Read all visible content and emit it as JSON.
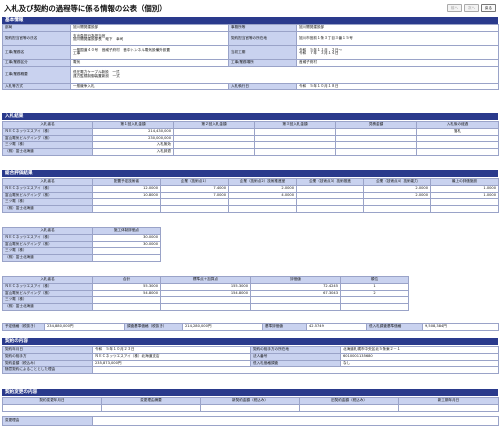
{
  "page": {
    "title": "入札及び契約の過程等に係る情報の公表（個別）",
    "buttons": [
      "前へ",
      "次へ",
      "戻る"
    ]
  },
  "sections": {
    "basic": "基本情報",
    "result": "入札結果",
    "eval": "総合評価結果",
    "contract": "契約の内容",
    "change": "契約変更の内容"
  },
  "basic": {
    "dept_label": "部局",
    "dept": "旭川開発建設部",
    "office_label": "事務所等",
    "office": "旭川開発建設部",
    "official_label": "契約担当官等の氏名",
    "official_1": "支出負担行為担当官",
    "official_2": "旭川開発建設部長　蛭下　幸司",
    "official_addr_label": "契約担当官等の所在地",
    "official_addr": "旭川市宮前１条３丁目３番１５号",
    "work_name_label": "工事/業務名",
    "work_name_1": "一般国道４０号　音威子府村　音中トンネル電気設備外設置",
    "work_name_2": "工事",
    "period_label": "当初工期",
    "period_1": "令和　５年１１月　２日～",
    "period_2": "令和　７年　３月１４日",
    "type_label": "工事/業務区分",
    "type": "電気",
    "place_label": "工事/業務場所",
    "place": "音威子府村",
    "overview_label": "工事/業務概要",
    "overview_1": "低圧電力ケーブル新設　一式",
    "overview_2": "遠方監視制御装置新設　一式",
    "method_label": "入札等方式",
    "method": "一般競争入札",
    "bid_date_label": "入札執行日",
    "bid_date": "令和　５年１０月１８日"
  },
  "bid_result": {
    "headers": [
      "入札者名",
      "第１回入札金額",
      "第２回入札金額",
      "第３回入札金額",
      "見積金額",
      "入札後の経過"
    ],
    "rows": [
      [
        "ＮＥＣネッツエスアイ（株）",
        "214,430,000",
        "",
        "",
        "",
        "落札"
      ],
      [
        "富山電気ビルデイング（株）",
        "230,000,000",
        "",
        "",
        "",
        ""
      ],
      [
        "三ツ電（株）",
        "入札無効",
        "",
        "",
        "",
        ""
      ],
      [
        "（株）富士北海道",
        "入札辞退",
        "",
        "",
        "",
        ""
      ]
    ]
  },
  "eval_result": {
    "t1_headers": [
      "入札者名",
      "配置予定技術者",
      "企業（技術点1）",
      "企業（技術点2）技術推進室",
      "企業（技術点3）技術推進",
      "企業（技術点4）技術能力",
      "最上の評価施設"
    ],
    "t1_rows": [
      [
        "ＮＥＣネッツエスアイ（株）",
        "12.0000",
        "7.4000",
        "2.0000",
        "",
        "2.0000",
        "1.0000"
      ],
      [
        "富山電気ビルデイング（株）",
        "10.8000",
        "7.0000",
        "4.0000",
        "",
        "2.0000",
        "1.0000"
      ],
      [
        "三ツ電（株）",
        "",
        "",
        "",
        "",
        "",
        ""
      ],
      [
        "（株）富士北海道",
        "",
        "",
        "",
        "",
        "",
        ""
      ]
    ],
    "t2_headers": [
      "入札者名",
      "施工体制評価点"
    ],
    "t2_rows": [
      [
        "ＮＥＣネッツエスアイ（株）",
        "30.0000"
      ],
      [
        "富山電気ビルデイング（株）",
        "30.0000"
      ],
      [
        "三ツ電（株）",
        ""
      ],
      [
        "（株）富士北海道",
        ""
      ]
    ],
    "t3_headers": [
      "入札者名",
      "合計",
      "標準点＋加算点",
      "評価値",
      "順位"
    ],
    "t3_rows": [
      [
        "ＮＥＣネッツエスアイ（株）",
        "55.3000",
        "155.3000",
        "72.4245",
        "1"
      ],
      [
        "富山電気ビルデイング（株）",
        "54.8000",
        "154.8000",
        "67.3043",
        "2"
      ],
      [
        "三ツ電（株）",
        "",
        "",
        "",
        ""
      ],
      [
        "（株）富士北海道",
        "",
        "",
        "",
        ""
      ]
    ],
    "summary": {
      "est_label": "予定価格（税抜き）",
      "est": "234,880,000円",
      "survey_label": "調査基準価格（税抜き）",
      "survey": "214,280,000円",
      "base_label": "基準評価値",
      "base": "42.5749",
      "low_label": "低入札調査基準価格",
      "low": "9,508,384円"
    }
  },
  "contract": {
    "date_label": "契約年月日",
    "date": "令和　５年１０月２３日",
    "party_addr_label": "契約の相手方の所在地",
    "party_addr": "北海道札幌市中央区北５条東２－１",
    "party_label": "契約の相手方",
    "party": "ＮＥＣネッツエスアイ（株）北海道支店",
    "corp_no_label": "法人番号",
    "corp_no": "6010001135680",
    "amount_label": "契約金額（税込み）",
    "amount": "235,873,000円",
    "low_survey_label": "低入札価格調査",
    "low_survey": "なし",
    "private_label": "随意契約によることとした理由",
    "private": ""
  },
  "change": {
    "headers": [
      "契約変更年月日",
      "変更理由摘要",
      "新契約金額（税込み）",
      "旧契約金額（税込み）",
      "新工期年月日"
    ],
    "row": [
      "",
      "",
      "",
      "",
      ""
    ],
    "reason_label": "変更理由",
    "reason": ""
  }
}
